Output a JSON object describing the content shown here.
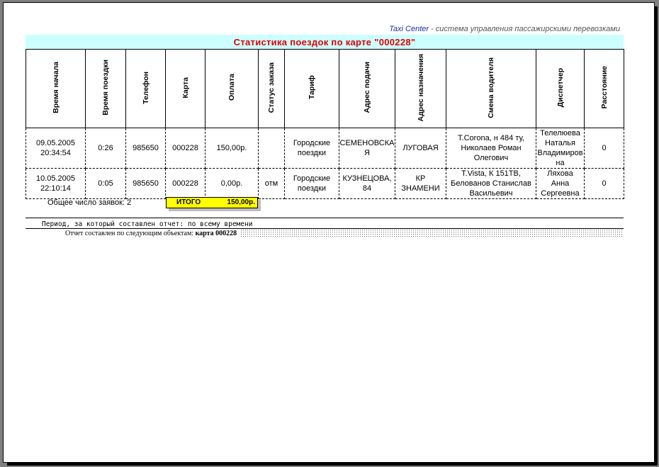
{
  "header": {
    "brand": "Taxi Center",
    "subtitle": " - система управления пассажирскими перевозками"
  },
  "report": {
    "title": "Статистика поездок по карте \"000228\"",
    "columns": [
      "Время начала",
      "Время поездки",
      "Телефон",
      "Карта",
      "Оплата",
      "Статус заказа",
      "Тариф",
      "Адрес подачи",
      "Адрес назначения",
      "Смена водителя",
      "Диспетчер",
      "Расстояние"
    ],
    "rows": [
      [
        "09.05.2005\n20:34:54",
        "0:26",
        "985650",
        "000228",
        "150,00р.",
        "",
        "Городские\nпоездки",
        "СЕМЕНОВСКА\nЯ",
        "ЛУГОВАЯ",
        "T.Corona, н 484 ту,\nНиколаев Роман\nОлегович",
        "Телелюева\nНаталья\nВладимиров\nна",
        "0"
      ],
      [
        "10.05.2005\n22:10:14",
        "0:05",
        "985650",
        "000228",
        "0,00р.",
        "отм",
        "Городские\nпоездки",
        "КУЗНЕЦОВА,\n84",
        "КР\nЗНАМЕНИ",
        "T.Vista, К 151ТВ,\nБелованов Станислав\nВасильевич",
        "Ляхова\nАнна\nСергеевна",
        "0"
      ]
    ],
    "total_requests": "Общее число заявок: 2",
    "total_label": "ИТОГО",
    "total_value": "150,00р.",
    "period": "Период, за который составлен отчет: по всему времени",
    "objects_label": "Отчет составлен по следующим объектам:",
    "objects_value": "карта 000228"
  }
}
